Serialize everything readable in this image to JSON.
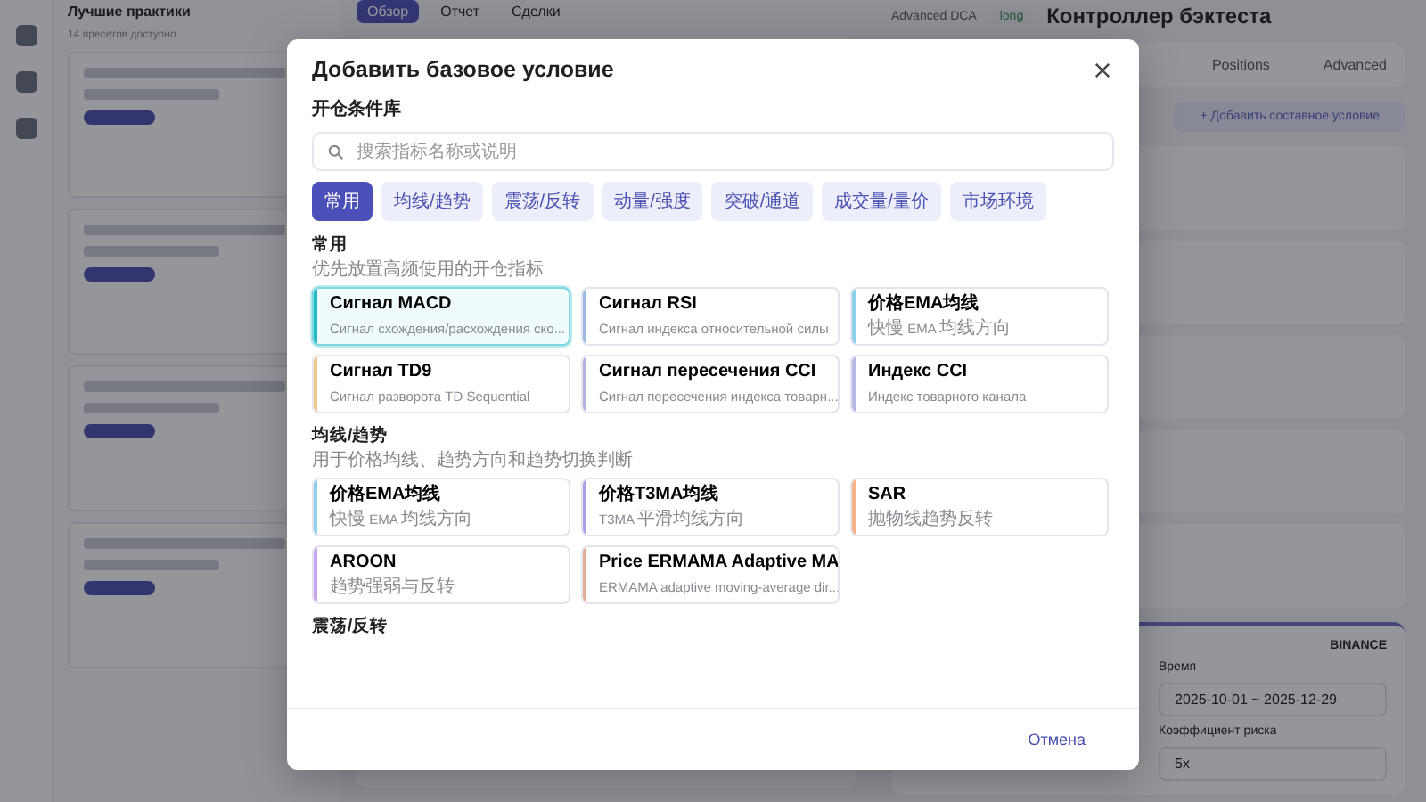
{
  "background": {
    "left_panel": {
      "title": "Лучшие практики",
      "subtitle": "14 пресетов доступно"
    },
    "tabs": [
      {
        "label": "Обзор",
        "selected": true
      },
      {
        "label": "Отчет",
        "selected": false
      },
      {
        "label": "Сделки",
        "selected": false
      }
    ],
    "header": {
      "strategy": "Advanced DCA",
      "side": "long",
      "title": "Контроллер бэктеста"
    },
    "right_tabs": [
      {
        "label": "Positions"
      },
      {
        "label": "Advanced"
      }
    ],
    "add_button": "+ Добавить составное условие",
    "settings": {
      "exchange": "BINANCE",
      "time_label": "Время",
      "time_value": "2025-10-01 ~ 2025-12-29",
      "risk_label": "Коэффициент риска",
      "risk_value": "5x"
    }
  },
  "modal": {
    "title": "Добавить базовое условие",
    "library_label": "开仓条件库",
    "search": {
      "placeholder": "搜索指标名称或说明"
    },
    "categories": [
      {
        "label": "常用",
        "selected": true
      },
      {
        "label": "均线/趋势",
        "selected": false
      },
      {
        "label": "震荡/反转",
        "selected": false
      },
      {
        "label": "动量/强度",
        "selected": false
      },
      {
        "label": "突破/通道",
        "selected": false
      },
      {
        "label": "成交量/量价",
        "selected": false
      },
      {
        "label": "市场环境",
        "selected": false
      }
    ],
    "sections": [
      {
        "title": "常用",
        "description": "优先放置高频使用的开仓指标",
        "items": [
          {
            "name": "Сигнал MACD",
            "description": "Сигнал схождения/расхождения ско...",
            "color": "#22b8c8",
            "selected": true
          },
          {
            "name": "Сигнал RSI",
            "description": "Сигнал индекса относительной силы",
            "color": "#9bb9e3",
            "selected": false
          },
          {
            "name": "价格EMA均线",
            "description": "快慢 EMA 均线方向",
            "color": "#8ecfea",
            "selected": false
          },
          {
            "name": "Сигнал TD9",
            "description": "Сигнал разворота TD Sequential",
            "color": "#f0c987",
            "selected": false
          },
          {
            "name": "Сигнал пересечения CCI",
            "description": "Сигнал пересечения индекса товарн...",
            "color": "#b3b3e2",
            "selected": false
          },
          {
            "name": "Индекс CCI",
            "description": "Индекс товарного канала",
            "color": "#b9b7e8",
            "selected": false
          }
        ]
      },
      {
        "title": "均线/趋势",
        "description": "用于价格均线、趋势方向和趋势切换判断",
        "items": [
          {
            "name": "价格EMA均线",
            "description": "快慢 EMA 均线方向",
            "color": "#8ecfea",
            "selected": false
          },
          {
            "name": "价格T3MA均线",
            "description": "T3MA 平滑均线方向",
            "color": "#a99ee8",
            "selected": false
          },
          {
            "name": "SAR",
            "description": "抛物线趋势反转",
            "color": "#f5b38a",
            "selected": false
          },
          {
            "name": "AROON",
            "description": "趋势强弱与反转",
            "color": "#c6a6ee",
            "selected": false
          },
          {
            "name": "Price ERMAMA Adaptive MA",
            "description": "ERMAMA adaptive moving-average dir...",
            "color": "#e8a89a",
            "selected": false
          }
        ]
      },
      {
        "title": "震荡/反转"
      }
    ],
    "cancel_button": "Отмена"
  }
}
